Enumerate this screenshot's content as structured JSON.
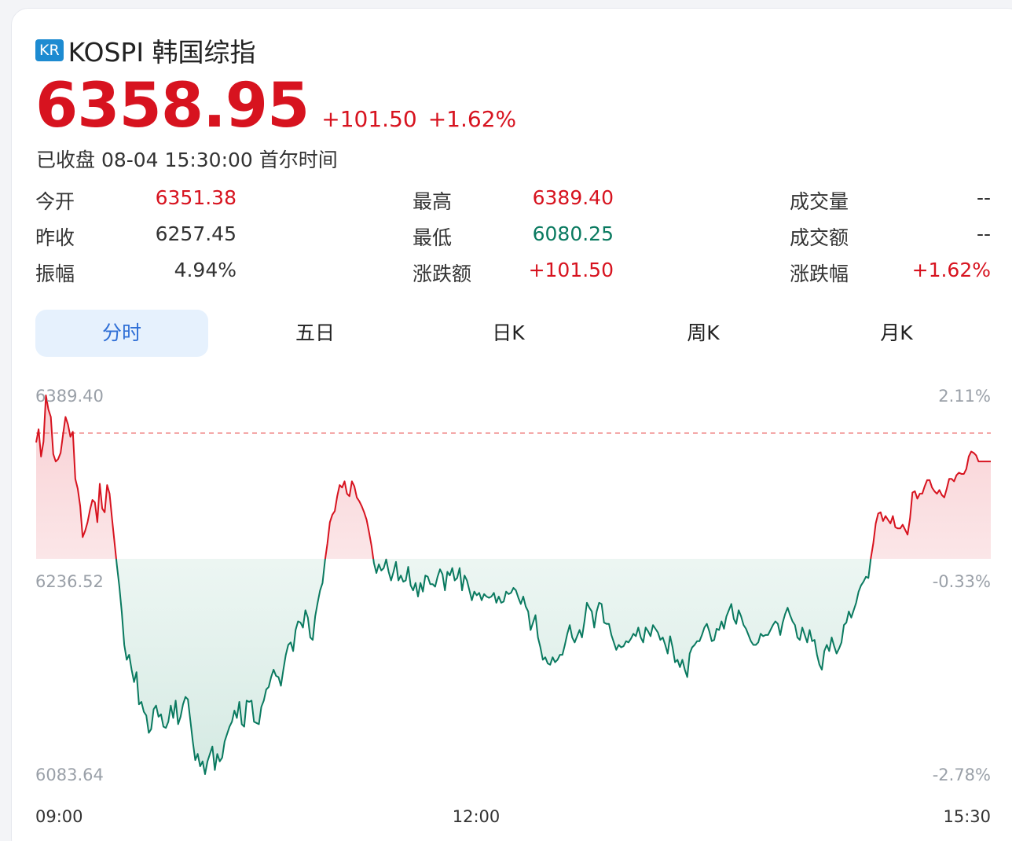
{
  "header": {
    "market_badge": "KR",
    "title": "KOSPI 韩国综指"
  },
  "quote": {
    "price": "6358.95",
    "change": "+101.50",
    "change_pct": "+1.62%",
    "status": "已收盘 08-04 15:30:00 首尔时间"
  },
  "stats": [
    [
      {
        "label": "今开",
        "value": "6351.38",
        "color": "red"
      },
      {
        "label": "最高",
        "value": "6389.40",
        "color": "red"
      },
      {
        "label": "成交量",
        "value": "--",
        "color": "dark"
      }
    ],
    [
      {
        "label": "昨收",
        "value": "6257.45",
        "color": "dark"
      },
      {
        "label": "最低",
        "value": "6080.25",
        "color": "green"
      },
      {
        "label": "成交额",
        "value": "--",
        "color": "dark"
      }
    ],
    [
      {
        "label": "振幅",
        "value": "4.94%",
        "color": "dark"
      },
      {
        "label": "涨跌额",
        "value": "+101.50",
        "color": "red"
      },
      {
        "label": "涨跌幅",
        "value": "+1.62%",
        "color": "red"
      }
    ]
  ],
  "tabs": [
    "分时",
    "五日",
    "日K",
    "周K",
    "月K"
  ],
  "active_tab": "分时",
  "colors": {
    "up": "#d7131f",
    "down": "#0a7a60",
    "accent": "#2f6fd6",
    "prev_close_line": "#f08c8c"
  },
  "chart_data": {
    "type": "line",
    "title": "",
    "prev_close": 6257.45,
    "ylim": [
      6083.64,
      6389.4
    ],
    "y_ticks_left": [
      "6389.40",
      "6236.52",
      "6083.64"
    ],
    "y_ticks_right": [
      "2.11%",
      "-0.33%",
      "-2.78%"
    ],
    "x_ticks": [
      "09:00",
      "12:00",
      "15:30"
    ],
    "x_range_minutes": [
      0,
      390
    ],
    "series": [
      {
        "values_x_minutes": [
          0,
          1,
          2,
          3,
          4,
          5,
          6,
          7,
          8,
          9,
          10,
          11,
          12,
          13,
          14,
          15,
          16,
          17,
          18,
          19,
          20,
          21,
          22,
          23,
          24,
          25,
          26,
          27,
          28,
          29,
          30,
          31,
          32,
          33,
          34,
          35,
          36,
          37,
          38,
          39,
          40,
          41,
          42,
          43,
          44,
          45,
          46,
          47,
          48,
          49,
          50,
          51,
          52,
          53,
          54,
          55,
          56,
          57,
          58,
          59,
          60,
          61,
          62,
          63,
          64,
          65,
          66,
          67,
          68,
          69,
          70,
          71,
          72,
          73,
          74,
          75,
          76,
          77,
          78,
          79,
          80,
          81,
          82,
          83,
          84,
          85,
          86,
          87,
          88,
          89,
          90,
          91,
          92,
          93,
          94,
          95,
          96,
          97,
          98,
          99,
          100,
          101,
          102,
          103,
          104,
          105,
          106,
          107,
          108,
          109,
          110,
          111,
          112,
          113,
          114,
          115,
          116,
          117,
          118,
          119,
          120,
          121,
          122,
          123,
          124,
          125,
          126,
          127,
          128,
          129,
          130,
          131,
          132,
          133,
          134,
          135,
          136,
          137,
          138,
          139,
          140,
          141,
          142,
          143,
          144,
          145,
          146,
          147,
          148,
          149,
          150,
          151,
          152,
          153,
          154,
          155,
          156,
          157,
          158,
          159,
          160,
          161,
          162,
          163,
          164,
          165,
          166,
          167,
          168,
          169,
          170,
          171,
          172,
          173,
          174,
          175,
          176,
          177,
          178,
          179,
          180,
          181,
          182,
          183,
          184,
          185,
          186,
          187,
          188,
          189,
          190,
          191,
          192,
          193,
          194,
          195,
          196,
          197,
          198,
          199,
          200,
          201,
          202,
          203,
          204,
          205,
          206,
          207,
          208,
          209,
          210,
          211,
          212,
          213,
          214,
          215,
          216,
          217,
          218,
          219,
          220,
          221,
          222,
          223,
          224,
          225,
          226,
          227,
          228,
          229,
          230,
          231,
          232,
          233,
          234,
          235,
          236,
          237,
          238,
          239,
          240,
          241,
          242,
          243,
          244,
          245,
          246,
          247,
          248,
          249,
          250,
          251,
          252,
          253,
          254,
          255,
          256,
          257,
          258,
          259,
          260,
          261,
          262,
          263,
          264,
          265,
          266,
          267,
          268,
          269,
          270,
          271,
          272,
          273,
          274,
          275,
          276,
          277,
          278,
          279,
          280,
          281,
          282,
          283,
          284,
          285,
          286,
          287,
          288,
          289,
          290,
          291,
          292,
          293,
          294,
          295,
          296,
          297,
          298,
          299,
          300,
          301,
          302,
          303,
          304,
          305,
          306,
          307,
          308,
          309,
          310,
          311,
          312,
          313,
          314,
          315,
          316,
          317,
          318,
          319,
          320,
          321,
          322,
          323,
          324,
          325,
          326,
          327,
          328,
          329,
          330,
          331,
          332,
          333,
          334,
          335,
          336,
          337,
          338,
          339,
          340,
          341,
          342,
          343,
          344,
          345,
          346,
          347,
          348,
          349,
          350,
          351,
          352,
          353,
          354,
          355,
          356,
          357,
          358,
          359,
          360,
          361,
          362,
          363,
          364,
          365,
          366,
          367,
          368,
          369,
          370,
          371,
          372,
          373,
          374,
          375,
          376,
          377,
          378,
          379,
          380,
          381,
          382,
          383,
          384,
          385,
          386,
          387,
          388,
          389,
          390
        ],
        "values": [
          6351.38,
          6362,
          6340,
          6352,
          6389.4,
          6378,
          6372,
          6342,
          6336,
          6338,
          6343,
          6358,
          6372,
          6366,
          6356,
          6360,
          6322,
          6314,
          6300,
          6275,
          6280,
          6287,
          6297,
          6305,
          6303,
          6287,
          6318,
          6298,
          6295,
          6317,
          6310,
          6290,
          6271,
          6252,
          6235,
          6214,
          6188,
          6176,
          6180,
          6168,
          6158,
          6166,
          6140,
          6142,
          6134,
          6131,
          6117,
          6120,
          6136,
          6139,
          6130,
          6132,
          6122,
          6121,
          6126,
          6139,
          6129,
          6143,
          6124,
          6130,
          6140,
          6146,
          6144,
          6127,
          6110,
          6095,
          6100,
          6090,
          6094,
          6083.64,
          6094,
          6100,
          6106,
          6087,
          6100,
          6094,
          6097,
          6110,
          6116,
          6122,
          6126,
          6135,
          6129,
          6142,
          6124,
          6122,
          6143,
          6142,
          6143,
          6126,
          6125,
          6124,
          6138,
          6143,
          6152,
          6154,
          6162,
          6168,
          6163,
          6162,
          6155,
          6168,
          6180,
          6188,
          6190,
          6183,
          6200,
          6207,
          6206,
          6202,
          6216,
          6210,
          6194,
          6192,
          6211,
          6222,
          6232,
          6238,
          6256,
          6270,
          6287,
          6293,
          6296,
          6308,
          6317,
          6315,
          6320,
          6310,
          6308,
          6320,
          6316,
          6307,
          6304,
          6300,
          6295,
          6289,
          6279,
          6268,
          6254,
          6246,
          6253,
          6248,
          6250,
          6257,
          6247,
          6240,
          6247,
          6255,
          6240,
          6244,
          6239,
          6240,
          6251,
          6236,
          6232,
          6238,
          6227,
          6238,
          6231,
          6244,
          6243,
          6237,
          6237,
          6235,
          6243,
          6249,
          6245,
          6232,
          6247,
          6244,
          6250,
          6240,
          6242,
          6250,
          6232,
          6244,
          6240,
          6232,
          6224,
          6231,
          6228,
          6230,
          6224,
          6229,
          6227,
          6226,
          6227,
          6230,
          6222,
          6227,
          6222,
          6223,
          6231,
          6229,
          6230,
          6234,
          6232,
          6226,
          6221,
          6227,
          6219,
          6215,
          6200,
          6206,
          6212,
          6194,
          6186,
          6176,
          6178,
          6173,
          6172,
          6178,
          6174,
          6176,
          6180,
          6180,
          6188,
          6197,
          6204,
          6194,
          6190,
          6195,
          6200,
          6194,
          6207,
          6222,
          6218,
          6215,
          6202,
          6215,
          6222,
          6221,
          6206,
          6205,
          6205,
          6196,
          6190,
          6184,
          6188,
          6186,
          6187,
          6191,
          6190,
          6193,
          6197,
          6195,
          6202,
          6194,
          6190,
          6202,
          6199,
          6195,
          6204,
          6201,
          6198,
          6192,
          6194,
          6188,
          6181,
          6195,
          6186,
          6174,
          6176,
          6170,
          6176,
          6168,
          6162,
          6181,
          6186,
          6188,
          6191,
          6191,
          6196,
          6202,
          6205,
          6199,
          6191,
          6192,
          6201,
          6200,
          6207,
          6201,
          6211,
          6216,
          6221,
          6209,
          6205,
          6216,
          6211,
          6204,
          6201,
          6196,
          6191,
          6188,
          6188,
          6190,
          6197,
          6195,
          6196,
          6196,
          6200,
          6204,
          6207,
          6205,
          6196,
          6206,
          6213,
          6218,
          6212,
          6207,
          6204,
          6194,
          6192,
          6202,
          6196,
          6190,
          6200,
          6191,
          6192,
          6180,
          6172,
          6168,
          6183,
          6188,
          6183,
          6194,
          6187,
          6181,
          6185,
          6190,
          6204,
          6206,
          6215,
          6210,
          6216,
          6222,
          6231,
          6236,
          6239,
          6243,
          6242,
          6258,
          6270,
          6286,
          6294,
          6295,
          6288,
          6292,
          6289,
          6286,
          6292,
          6283,
          6282,
          6282,
          6285,
          6281,
          6277,
          6290,
          6311,
          6312,
          6306,
          6310,
          6310,
          6316,
          6321,
          6321,
          6315,
          6312,
          6310,
          6313,
          6309,
          6307,
          6314,
          6322,
          6322,
          6320,
          6325,
          6327,
          6326,
          6326,
          6330,
          6340,
          6344,
          6343,
          6341,
          6336,
          6336,
          6336,
          6336,
          6336,
          6336,
          6336,
          6336,
          6336,
          6343
        ]
      }
    ],
    "grid": false,
    "legend": "none"
  }
}
